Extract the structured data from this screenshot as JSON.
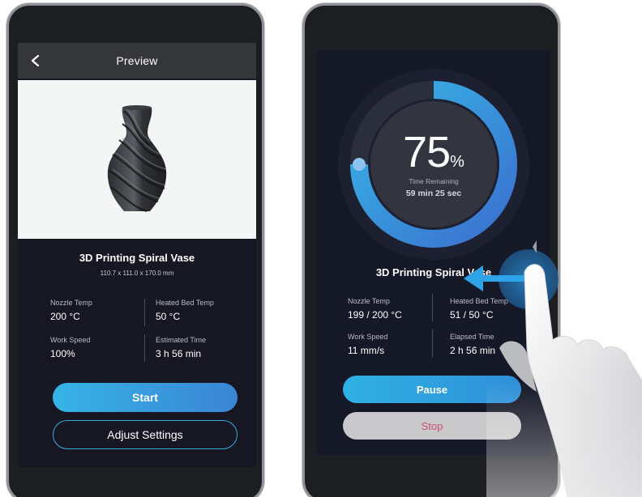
{
  "left_screen": {
    "header": {
      "title": "Preview",
      "back_icon": "chevron-left-icon"
    },
    "model": {
      "name": "3D Printing Spiral Vase",
      "dimensions": "110.7 x 111.0 x 170.0 mm",
      "image": "spiral-vase-model"
    },
    "stats": [
      {
        "label": "Nozzle Temp",
        "value": "200 °C"
      },
      {
        "label": "Heated Bed Temp",
        "value": "50 °C"
      },
      {
        "label": "Work Speed",
        "value": "100%"
      },
      {
        "label": "Estimated Time",
        "value": "3 h 56 min"
      }
    ],
    "buttons": {
      "start": "Start",
      "adjust": "Adjust Settings"
    }
  },
  "right_screen": {
    "progress": {
      "percent": "75",
      "unit": "%",
      "fraction": 0.75,
      "label": "Time Remaining",
      "remaining": "59 min 25 sec"
    },
    "model_name": "3D Printing Spiral Vase",
    "stats": [
      {
        "label": "Nozzle Temp",
        "value": "199 / 200 °C"
      },
      {
        "label": "Heated Bed Temp",
        "value": "51 / 50 °C"
      },
      {
        "label": "Work Speed",
        "value": "11 mm/s"
      },
      {
        "label": "Elapsed Time",
        "value": "2 h 56 min"
      }
    ],
    "buttons": {
      "pause": "Pause",
      "stop": "Stop"
    },
    "gesture": {
      "type": "swipe-left",
      "icons": [
        "hand-pointer-icon",
        "arrow-left-icon",
        "tap-ripple-icon"
      ]
    }
  },
  "colors": {
    "accent": "#34aee5",
    "accent_dark": "#3a7fd0",
    "screen_bg": "#161723",
    "stop_text": "#d04a77"
  }
}
